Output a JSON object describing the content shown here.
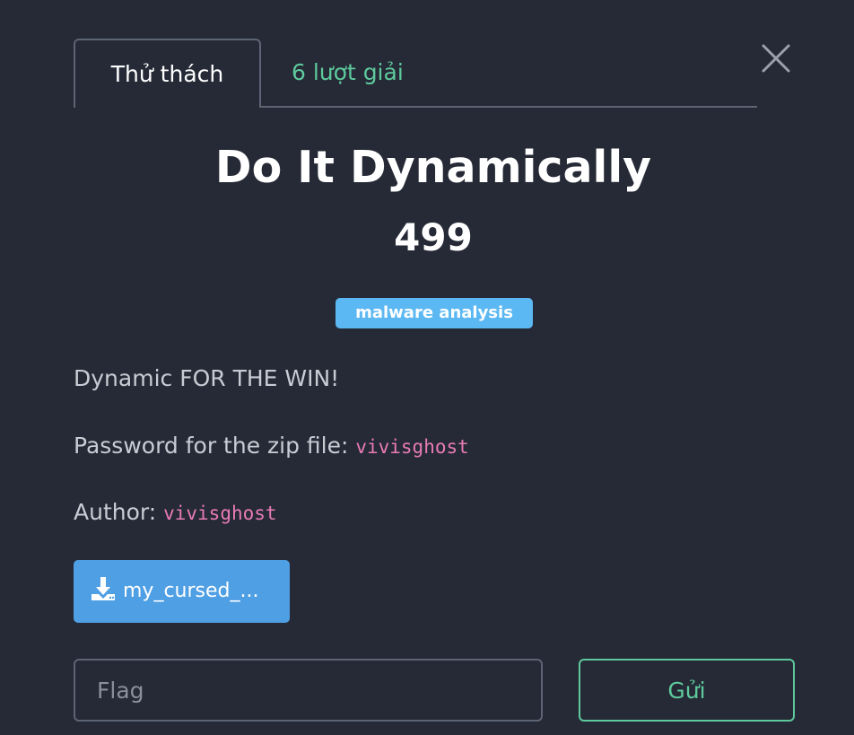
{
  "tabs": {
    "challenge": "Thử thách",
    "solves": "6 lượt giải"
  },
  "challenge": {
    "name": "Do It Dynamically",
    "value": "499",
    "tag": "malware analysis",
    "description_line": "Dynamic FOR THE WIN!",
    "password_label": "Password for the zip file: ",
    "password_value": "vivisghost",
    "author_label": "Author: ",
    "author_value": "vivisghost"
  },
  "download": {
    "label": "my_cursed_..."
  },
  "submission": {
    "placeholder": "Flag",
    "submit_label": "Gửi"
  },
  "colors": {
    "background": "#252a36",
    "accent_green": "#5ec99c",
    "tag_blue": "#5cb8f2",
    "button_blue": "#4f9fe4",
    "code_pink": "#e97bb5"
  },
  "icons": {
    "close": "close-icon",
    "download": "download-icon"
  }
}
